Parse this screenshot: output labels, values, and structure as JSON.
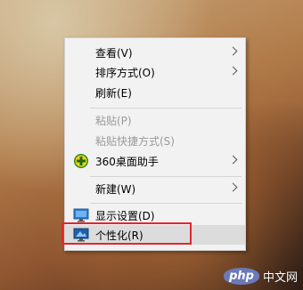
{
  "menu": {
    "items": [
      {
        "label": "查看(V)",
        "submenu": true
      },
      {
        "label": "排序方式(O)",
        "submenu": true
      },
      {
        "label": "刷新(E)",
        "submenu": false
      },
      {
        "label": "粘贴(P)",
        "disabled": true
      },
      {
        "label": "粘贴快捷方式(S)",
        "disabled": true
      },
      {
        "label": "360桌面助手",
        "submenu": true,
        "icon": "360-assistant-icon"
      },
      {
        "label": "新建(W)",
        "submenu": true
      },
      {
        "label": "显示设置(D)",
        "icon": "display-settings-icon"
      },
      {
        "label": "个性化(R)",
        "icon": "personalize-icon",
        "highlighted": true
      }
    ]
  },
  "watermark": {
    "badge": "php",
    "text": "中文网"
  },
  "colors": {
    "menu_bg": "#f2f2f2",
    "highlight": "#dcdcdc",
    "annotation_box": "#e2262e"
  }
}
